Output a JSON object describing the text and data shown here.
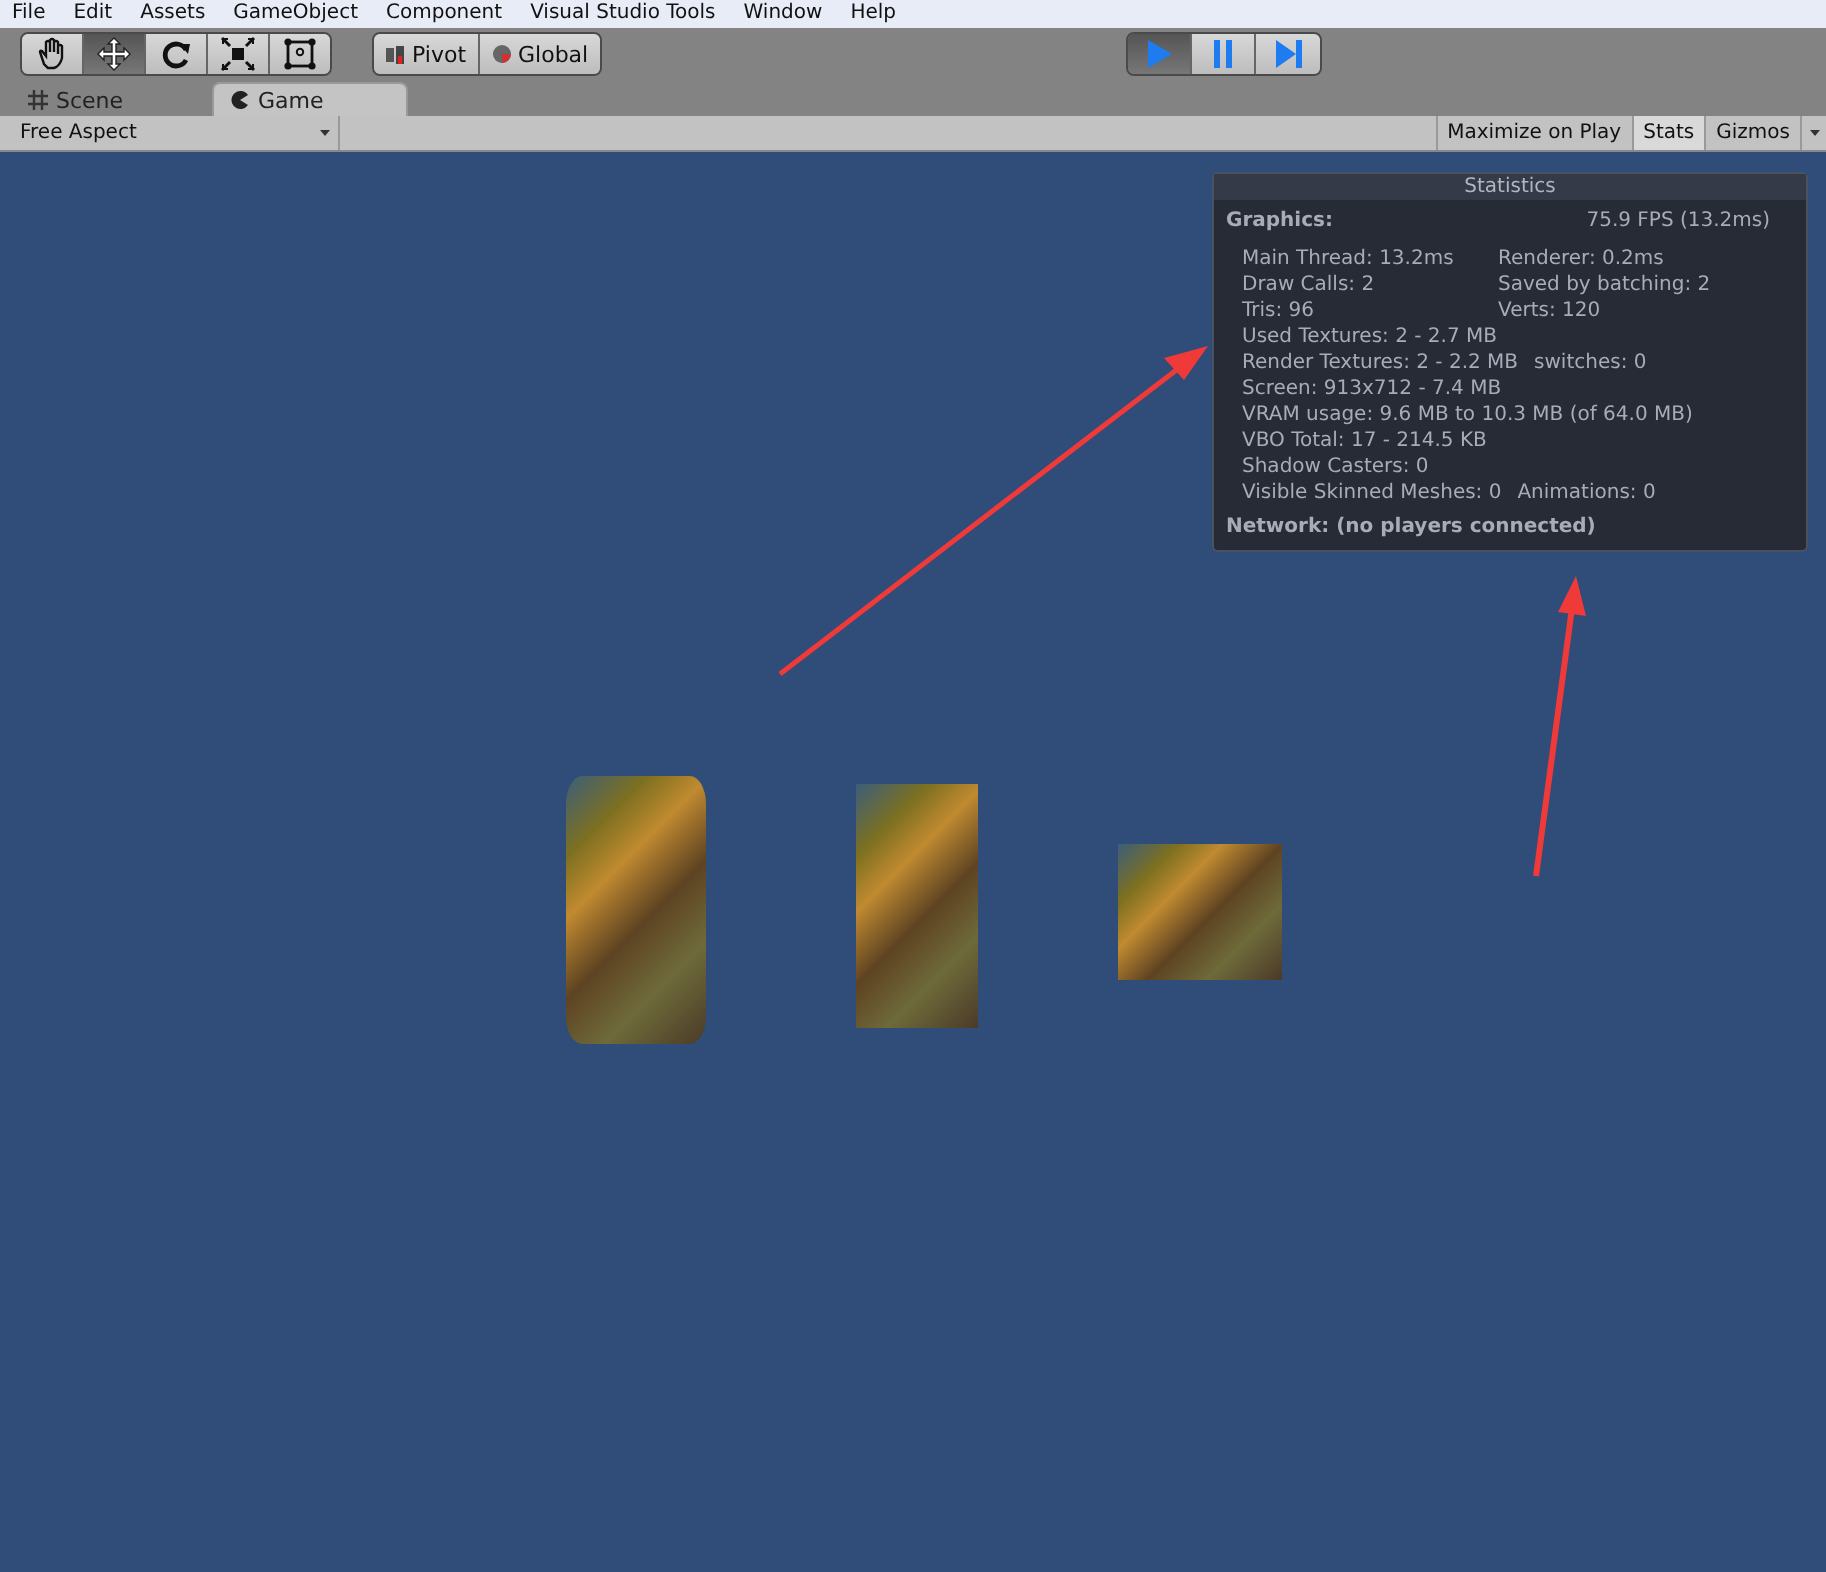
{
  "menu": [
    "File",
    "Edit",
    "Assets",
    "GameObject",
    "Component",
    "Visual Studio Tools",
    "Window",
    "Help"
  ],
  "tools": [
    {
      "kind": "hand",
      "selected": false
    },
    {
      "kind": "move",
      "selected": true
    },
    {
      "kind": "rotate",
      "selected": false
    },
    {
      "kind": "scale",
      "selected": false
    },
    {
      "kind": "rect",
      "selected": false
    }
  ],
  "pivot_buttons": [
    {
      "kind": "pivot",
      "label": "Pivot"
    },
    {
      "kind": "global",
      "label": "Global"
    }
  ],
  "playback": [
    {
      "kind": "play",
      "selected": true
    },
    {
      "kind": "pause",
      "selected": false
    },
    {
      "kind": "step",
      "selected": false
    }
  ],
  "tabs": [
    {
      "kind": "scene",
      "label": "Scene",
      "selected": false
    },
    {
      "kind": "game",
      "label": "Game",
      "selected": true
    }
  ],
  "game_toolbar": {
    "aspect": "Free Aspect",
    "toggles": [
      {
        "label": "Maximize on Play",
        "on": false
      },
      {
        "label": "Stats",
        "on": true
      },
      {
        "label": "Gizmos",
        "on": false
      }
    ]
  },
  "statistics": {
    "title": "Statistics",
    "graphics_label": "Graphics:",
    "fps": "75.9 FPS (13.2ms)",
    "rows": [
      [
        "Main Thread: 13.2ms",
        "Renderer: 0.2ms"
      ],
      [
        "Draw Calls: 2",
        "Saved by batching: 2"
      ],
      [
        "Tris: 96",
        "Verts: 120"
      ],
      [
        "Used Textures: 2 - 2.7 MB"
      ],
      [
        "Render Textures: 2 - 2.2 MB",
        "switches: 0"
      ],
      [
        "Screen: 913x712 - 7.4 MB"
      ],
      [
        "VRAM usage: 9.6 MB to 10.3 MB (of 64.0 MB)"
      ],
      [
        "VBO Total: 17 - 214.5 KB"
      ],
      [
        "Shadow Casters: 0"
      ],
      [
        "Visible Skinned Meshes: 0",
        "Animations: 0"
      ]
    ],
    "network": "Network: (no players connected)"
  },
  "scene_objects": [
    {
      "kind": "cylinder"
    },
    {
      "kind": "panel"
    },
    {
      "kind": "cube"
    }
  ]
}
